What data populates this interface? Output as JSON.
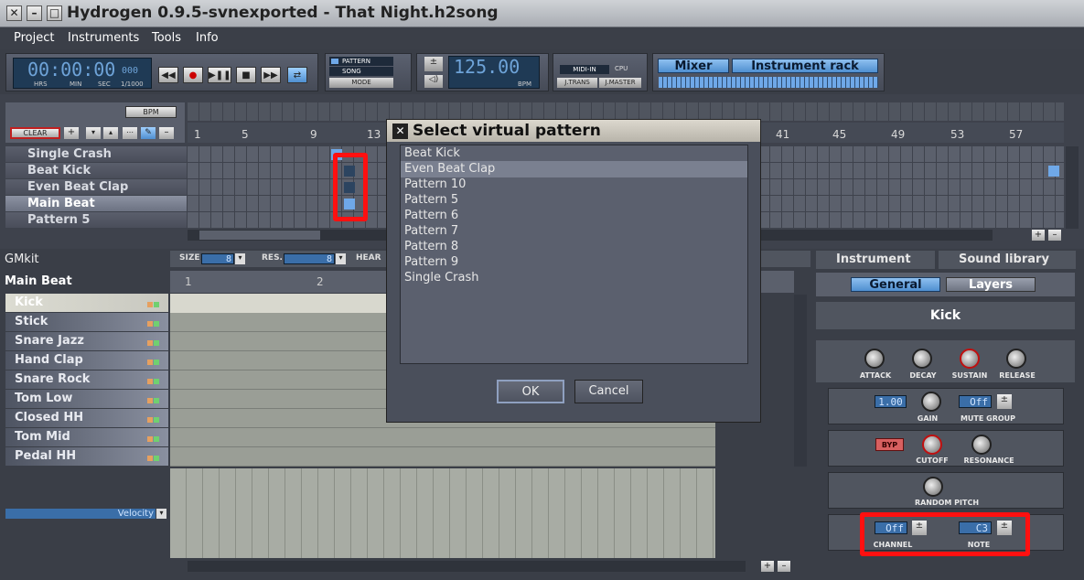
{
  "window": {
    "title": "Hydrogen 0.9.5-svnexported - That Night.h2song"
  },
  "menu": [
    "Project",
    "Instruments",
    "Tools",
    "Info"
  ],
  "transport": {
    "time": "00:00:00",
    "time_ms": "000",
    "time_labels": [
      "HRS",
      "MIN",
      "SEC",
      "1/1000"
    ],
    "mode_pattern": "PATTERN",
    "mode_song": "SONG",
    "mode_label": "MODE",
    "bpm": "125.00",
    "bpm_label": "BPM",
    "midi_in": "MIDI-IN",
    "cpu": "CPU",
    "jtrans": "J.TRANS",
    "jmaster": "J.MASTER",
    "mixer": "Mixer",
    "instrument_rack": "Instrument rack"
  },
  "song_editor": {
    "clear": "CLEAR",
    "bpm_btn": "BPM",
    "ruler": [
      "1",
      "5",
      "9",
      "13",
      "41",
      "45",
      "49",
      "53",
      "57"
    ],
    "patterns": [
      "Single Crash",
      "Beat Kick",
      "Even Beat Clap",
      "Main Beat",
      "Pattern 5"
    ]
  },
  "pattern_editor": {
    "drumkit": "GMkit",
    "pattern_name": "Main Beat",
    "size_label": "SIZE",
    "size_value": "8",
    "res_label": "RES.",
    "res_value": "8",
    "hear_label": "HEAR",
    "beats": [
      "1",
      "2"
    ],
    "instruments": [
      "Kick",
      "Stick",
      "Snare Jazz",
      "Hand Clap",
      "Snare Rock",
      "Tom Low",
      "Closed HH",
      "Tom Mid",
      "Pedal HH"
    ],
    "velocity": "Velocity"
  },
  "instrument_panel": {
    "tab_instrument": "Instrument",
    "tab_sound_library": "Sound library",
    "general": "General",
    "layers": "Layers",
    "name": "Kick",
    "knobs_adsr": [
      "ATTACK",
      "DECAY",
      "SUSTAIN",
      "RELEASE"
    ],
    "gain_value": "1.00",
    "gain_label": "GAIN",
    "mute_value": "Off",
    "mute_label": "MUTE GROUP",
    "byp": "BYP",
    "cutoff": "CUTOFF",
    "resonance": "RESONANCE",
    "random_pitch": "RANDOM PITCH",
    "channel_value": "Off",
    "channel_label": "CHANNEL",
    "note_value": "C3",
    "note_label": "NOTE"
  },
  "dialog": {
    "title": "Select virtual pattern",
    "items": [
      "Beat Kick",
      "Even Beat Clap",
      "Pattern 10",
      "Pattern 5",
      "Pattern 6",
      "Pattern 7",
      "Pattern 8",
      "Pattern 9",
      "Single Crash"
    ],
    "ok": "OK",
    "cancel": "Cancel"
  },
  "colors": {
    "highlight": "#ff1010",
    "accent": "#6fa8e8"
  }
}
